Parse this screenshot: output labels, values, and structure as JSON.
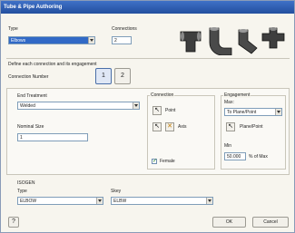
{
  "window": {
    "title": "Tube & Pipe Authoring"
  },
  "type_section": {
    "label": "Type",
    "value": "Elbows"
  },
  "connections": {
    "label": "Connections",
    "value": "2"
  },
  "engagement_header": "Define each connection and its engagement",
  "connection_number": {
    "label": "Connection Number",
    "buttons": [
      "1",
      "2"
    ]
  },
  "end_treatment": {
    "label": "End Treatment",
    "value": "Welded"
  },
  "nominal_size": {
    "label": "Nominal Size",
    "value": "1"
  },
  "connection_group": {
    "title": "Connection",
    "point_label": "Point",
    "axis_label": "Axis",
    "female_label": "Female"
  },
  "engagement_group": {
    "title": "Engagement",
    "max_label": "Max:",
    "max_value": "To Plane/Point",
    "plane_point_label": "Plane/Point",
    "min_label": "Min",
    "min_value": "50.000",
    "min_unit": "% of Max"
  },
  "isogen": {
    "title": "ISOGEN",
    "type_label": "Type",
    "type_value": "ELBOW",
    "skey_label": "Skey",
    "skey_value": "ELBW"
  },
  "footer": {
    "ok": "OK",
    "cancel": "Cancel"
  }
}
